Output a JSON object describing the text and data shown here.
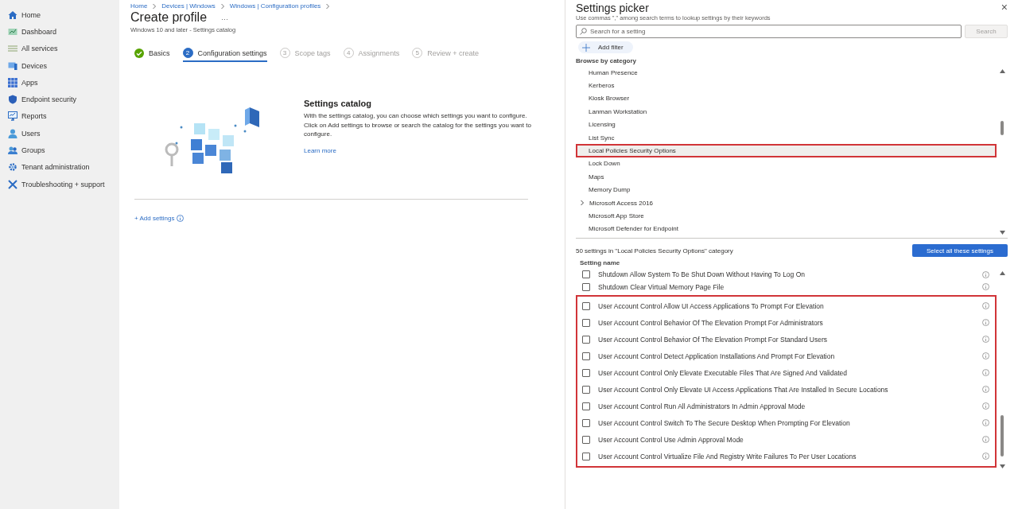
{
  "sidebar": {
    "items": [
      {
        "label": "Home"
      },
      {
        "label": "Dashboard"
      },
      {
        "label": "All services"
      },
      {
        "label": "Devices"
      },
      {
        "label": "Apps"
      },
      {
        "label": "Endpoint security"
      },
      {
        "label": "Reports"
      },
      {
        "label": "Users"
      },
      {
        "label": "Groups"
      },
      {
        "label": "Tenant administration"
      },
      {
        "label": "Troubleshooting + support"
      }
    ]
  },
  "main": {
    "breadcrumb": [
      "Home",
      "Devices | Windows",
      "Windows | Configuration profiles"
    ],
    "title": "Create profile",
    "more": "···",
    "subtitle": "Windows 10 and later - Settings catalog",
    "steps": [
      {
        "label": "Basics",
        "kind": "check",
        "selected": false,
        "disabled": false
      },
      {
        "label": "Configuration settings",
        "kind": "numbered",
        "number": "2",
        "selected": true,
        "disabled": false
      },
      {
        "label": "Scope tags",
        "kind": "numbered",
        "number": "3",
        "selected": false,
        "disabled": true
      },
      {
        "label": "Assignments",
        "kind": "numbered",
        "number": "4",
        "selected": false,
        "disabled": true
      },
      {
        "label": "Review + create",
        "kind": "numbered",
        "number": "5",
        "selected": false,
        "disabled": true
      }
    ],
    "catalog": {
      "title": "Settings catalog",
      "text": "With the settings catalog, you can choose which settings you want to configure. Click on Add settings to browse or search the catalog for the settings you want to configure.",
      "link": "Learn more"
    },
    "add_settings": "+ Add settings"
  },
  "picker": {
    "title": "Settings picker",
    "close": "×",
    "hint": "Use commas \",\" among search terms to lookup settings by their keywords",
    "search": {
      "placeholder": "Search for a setting",
      "button": "Search"
    },
    "add_filter": "Add filter",
    "browse_label": "Browse by category",
    "categories": [
      {
        "label": "Human Presence",
        "selected": false,
        "expandable": false,
        "highlighted": false
      },
      {
        "label": "Kerberos",
        "selected": false,
        "expandable": false,
        "highlighted": false
      },
      {
        "label": "Kiosk Browser",
        "selected": false,
        "expandable": false,
        "highlighted": false
      },
      {
        "label": "Lanman Workstation",
        "selected": false,
        "expandable": false,
        "highlighted": false
      },
      {
        "label": "Licensing",
        "selected": false,
        "expandable": false,
        "highlighted": false
      },
      {
        "label": "List Sync",
        "selected": false,
        "expandable": false,
        "highlighted": false
      },
      {
        "label": "Local Policies Security Options",
        "selected": true,
        "expandable": false,
        "highlighted": true
      },
      {
        "label": "Lock Down",
        "selected": false,
        "expandable": false,
        "highlighted": false
      },
      {
        "label": "Maps",
        "selected": false,
        "expandable": false,
        "highlighted": false
      },
      {
        "label": "Memory Dump",
        "selected": false,
        "expandable": false,
        "highlighted": false
      },
      {
        "label": "Microsoft Access 2016",
        "selected": false,
        "expandable": true,
        "highlighted": false
      },
      {
        "label": "Microsoft App Store",
        "selected": false,
        "expandable": false,
        "highlighted": false
      },
      {
        "label": "Microsoft Defender for Endpoint",
        "selected": false,
        "expandable": false,
        "highlighted": false
      }
    ],
    "count_text": "50 settings in \"Local Policies Security Options\" category",
    "select_all": "Select all these settings",
    "column": "Setting name",
    "rows": [
      {
        "label": "Shutdown Allow System To Be Shut Down Without Having To Log On",
        "checked": false
      },
      {
        "label": "Shutdown Clear Virtual Memory Page File",
        "checked": false
      }
    ],
    "highlighted_rows": [
      {
        "label": "User Account Control Allow UI Access Applications To Prompt For Elevation",
        "checked": false
      },
      {
        "label": "User Account Control Behavior Of The Elevation Prompt For Administrators",
        "checked": false
      },
      {
        "label": "User Account Control Behavior Of The Elevation Prompt For Standard Users",
        "checked": false
      },
      {
        "label": "User Account Control Detect Application Installations And Prompt For Elevation",
        "checked": false
      },
      {
        "label": "User Account Control Only Elevate Executable Files That Are Signed And Validated",
        "checked": false
      },
      {
        "label": "User Account Control Only Elevate UI Access Applications That Are Installed In Secure Locations",
        "checked": false
      },
      {
        "label": "User Account Control Run All Administrators In Admin Approval Mode",
        "checked": false
      },
      {
        "label": "User Account Control Switch To The Secure Desktop When Prompting For Elevation",
        "checked": false
      },
      {
        "label": "User Account Control Use Admin Approval Mode",
        "checked": false
      },
      {
        "label": "User Account Control Virtualize File And Registry Write Failures To Per User Locations",
        "checked": false
      }
    ]
  }
}
